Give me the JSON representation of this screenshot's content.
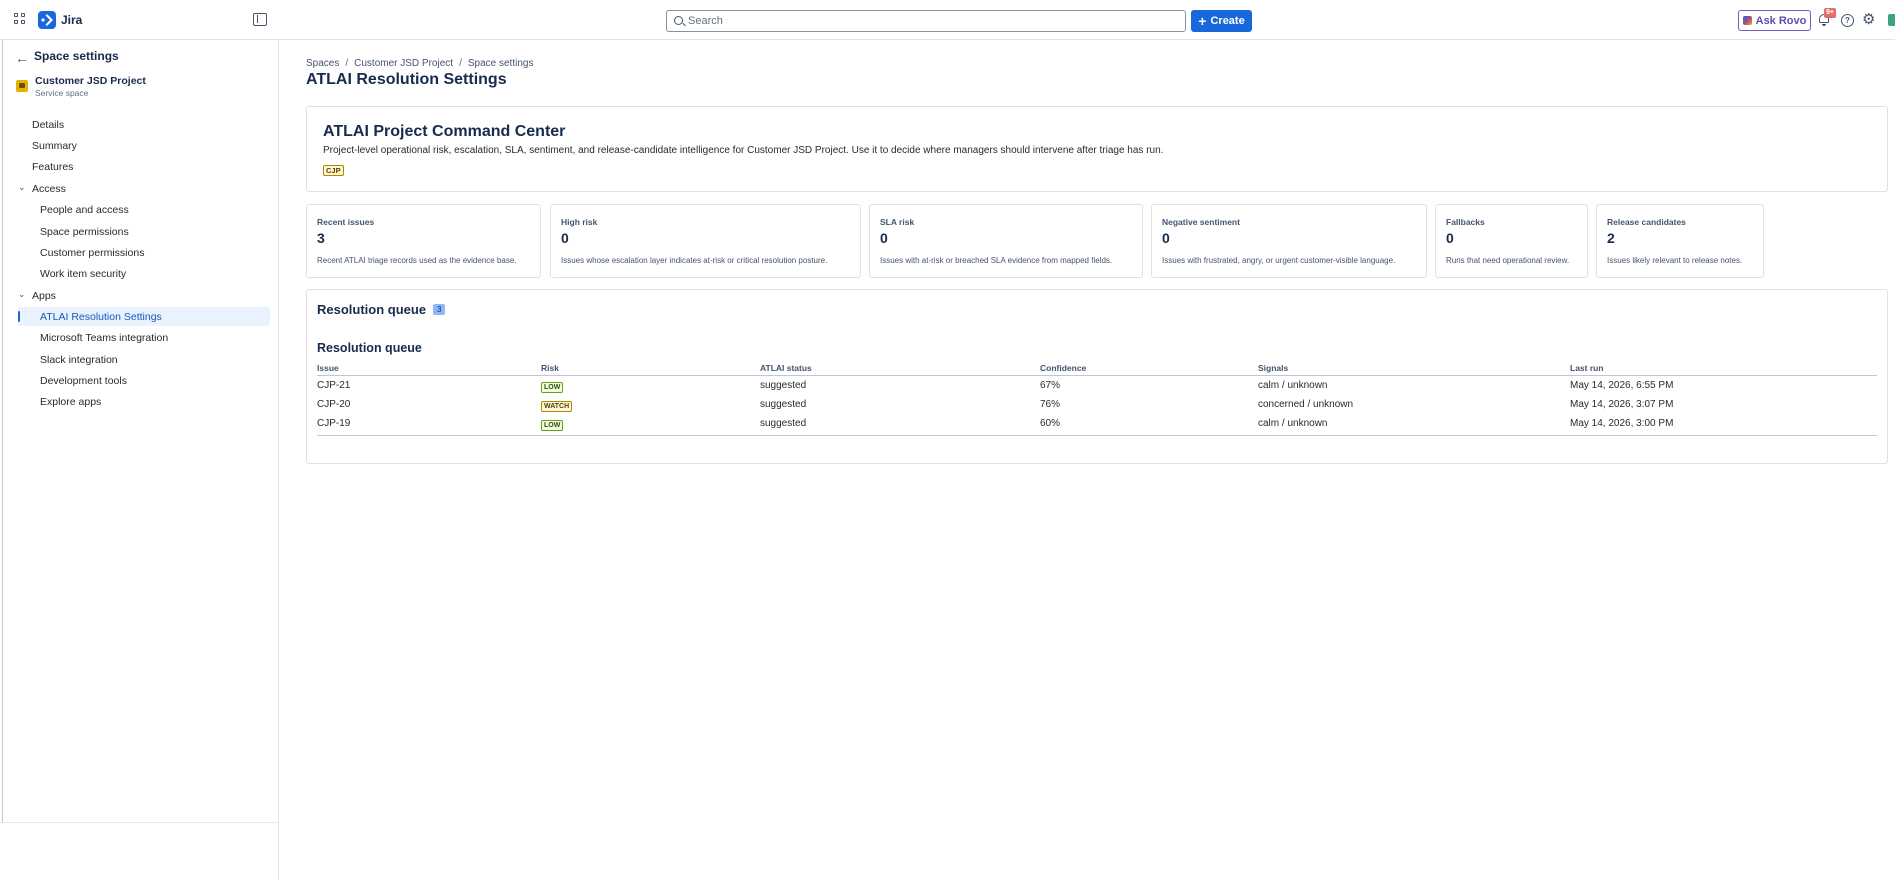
{
  "app": {
    "brand": "Jira"
  },
  "search": {
    "placeholder": "Search"
  },
  "header": {
    "create_label": "Create",
    "ask_rovo_label": "Ask Rovo",
    "notification_badge": "9+",
    "icons": [
      "app-switcher-icon",
      "jira-logo-icon",
      "sidebar-toggle-icon",
      "search-icon",
      "plus-icon",
      "rovo-icon",
      "bell-icon",
      "help-icon",
      "gear-icon"
    ]
  },
  "sidebar": {
    "title": "Space settings",
    "project": {
      "name": "Customer JSD Project",
      "type": "Service space"
    },
    "items": [
      {
        "label": "Details",
        "level": 1
      },
      {
        "label": "Summary",
        "level": 1
      },
      {
        "label": "Features",
        "level": 1
      },
      {
        "label": "Access",
        "level": 0,
        "group": true
      },
      {
        "label": "People and access",
        "level": 2
      },
      {
        "label": "Space permissions",
        "level": 2
      },
      {
        "label": "Customer permissions",
        "level": 2
      },
      {
        "label": "Work item security",
        "level": 2
      },
      {
        "label": "Apps",
        "level": 0,
        "group": true
      },
      {
        "label": "ATLAI Resolution Settings",
        "level": 2,
        "active": true
      },
      {
        "label": "Microsoft Teams integration",
        "level": 2
      },
      {
        "label": "Slack integration",
        "level": 2
      },
      {
        "label": "Development tools",
        "level": 2
      },
      {
        "label": "Explore apps",
        "level": 2
      }
    ]
  },
  "breadcrumb": [
    "Spaces",
    "Customer JSD Project",
    "Space settings"
  ],
  "page": {
    "title": "ATLAI Resolution Settings"
  },
  "hero": {
    "title": "ATLAI Project Command Center",
    "description": "Project-level operational risk, escalation, SLA, sentiment, and release-candidate intelligence for Customer JSD Project. Use it to decide where managers should intervene after triage has run.",
    "tag": "CJP"
  },
  "stats": [
    {
      "title": "Recent issues",
      "value": "3",
      "desc": "Recent ATLAI triage records used as the evidence base."
    },
    {
      "title": "High risk",
      "value": "0",
      "desc": "Issues whose escalation layer indicates at-risk or critical resolution posture."
    },
    {
      "title": "SLA risk",
      "value": "0",
      "desc": "Issues with at-risk or breached SLA evidence from mapped fields."
    },
    {
      "title": "Negative sentiment",
      "value": "0",
      "desc": "Issues with frustrated, angry, or urgent customer-visible language."
    },
    {
      "title": "Fallbacks",
      "value": "0",
      "desc": "Runs that need operational review."
    },
    {
      "title": "Release candidates",
      "value": "2",
      "desc": "Issues likely relevant to release notes."
    }
  ],
  "queue": {
    "title": "Resolution queue",
    "count": "3",
    "table_title": "Resolution queue",
    "columns": [
      "Issue",
      "Risk",
      "ATLAI status",
      "Confidence",
      "Signals",
      "Last run"
    ],
    "rows": [
      {
        "issue": "CJP-21",
        "risk": "LOW",
        "status": "suggested",
        "confidence": "67%",
        "signals": "calm / unknown",
        "last_run": "May 14, 2026, 6:55 PM"
      },
      {
        "issue": "CJP-20",
        "risk": "WATCH",
        "status": "suggested",
        "confidence": "76%",
        "signals": "concerned / unknown",
        "last_run": "May 14, 2026, 3:07 PM"
      },
      {
        "issue": "CJP-19",
        "risk": "LOW",
        "status": "suggested",
        "confidence": "60%",
        "signals": "calm / unknown",
        "last_run": "May 14, 2026, 3:00 PM"
      }
    ]
  },
  "colors": {
    "accent": "#1868db",
    "rovo": "#6e5dc6",
    "low": "#6a9a23",
    "watch": "#b38600"
  }
}
